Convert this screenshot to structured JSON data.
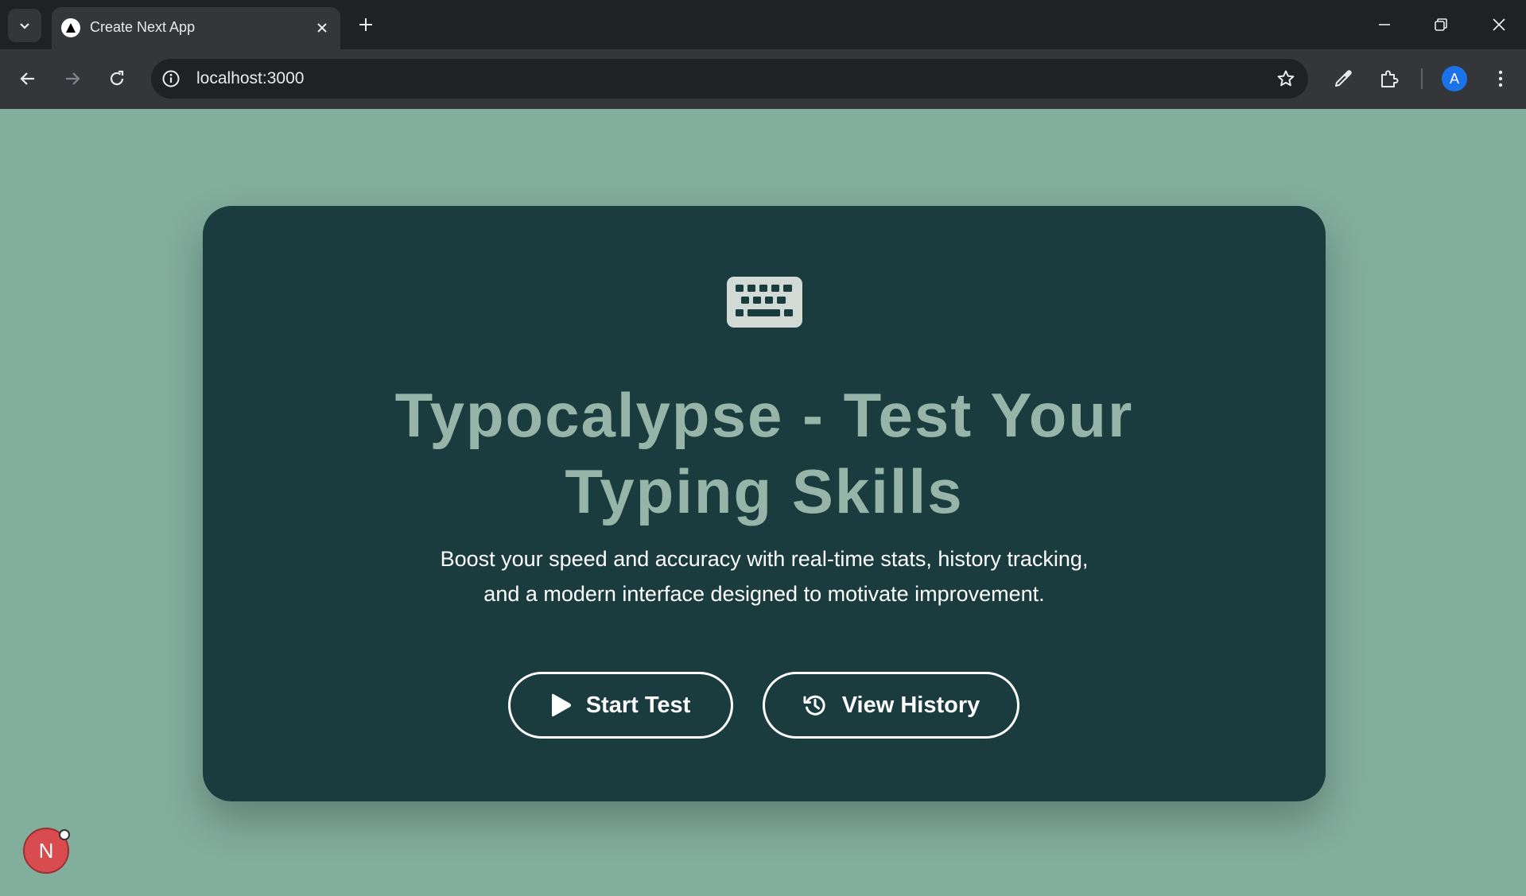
{
  "browser": {
    "tab_title": "Create Next App",
    "url": "localhost:3000",
    "profile_initial": "A"
  },
  "page": {
    "headline_line1": "Typocalypse - Test Your",
    "headline_line2": "Typing Skills",
    "subtitle_line1": "Boost your speed and accuracy with real-time stats, history tracking,",
    "subtitle_line2": "and a modern interface designed to motivate improvement.",
    "start_button": "Start Test",
    "history_button": "View History",
    "dev_badge": "N"
  },
  "colors": {
    "page_background": "#82ae9e",
    "card_background": "#1a3c3e",
    "headline": "#97b4a9",
    "button_border": "#ffffff"
  },
  "icons": {
    "hero": "keyboard-icon",
    "start": "play-icon",
    "history": "history-icon"
  }
}
